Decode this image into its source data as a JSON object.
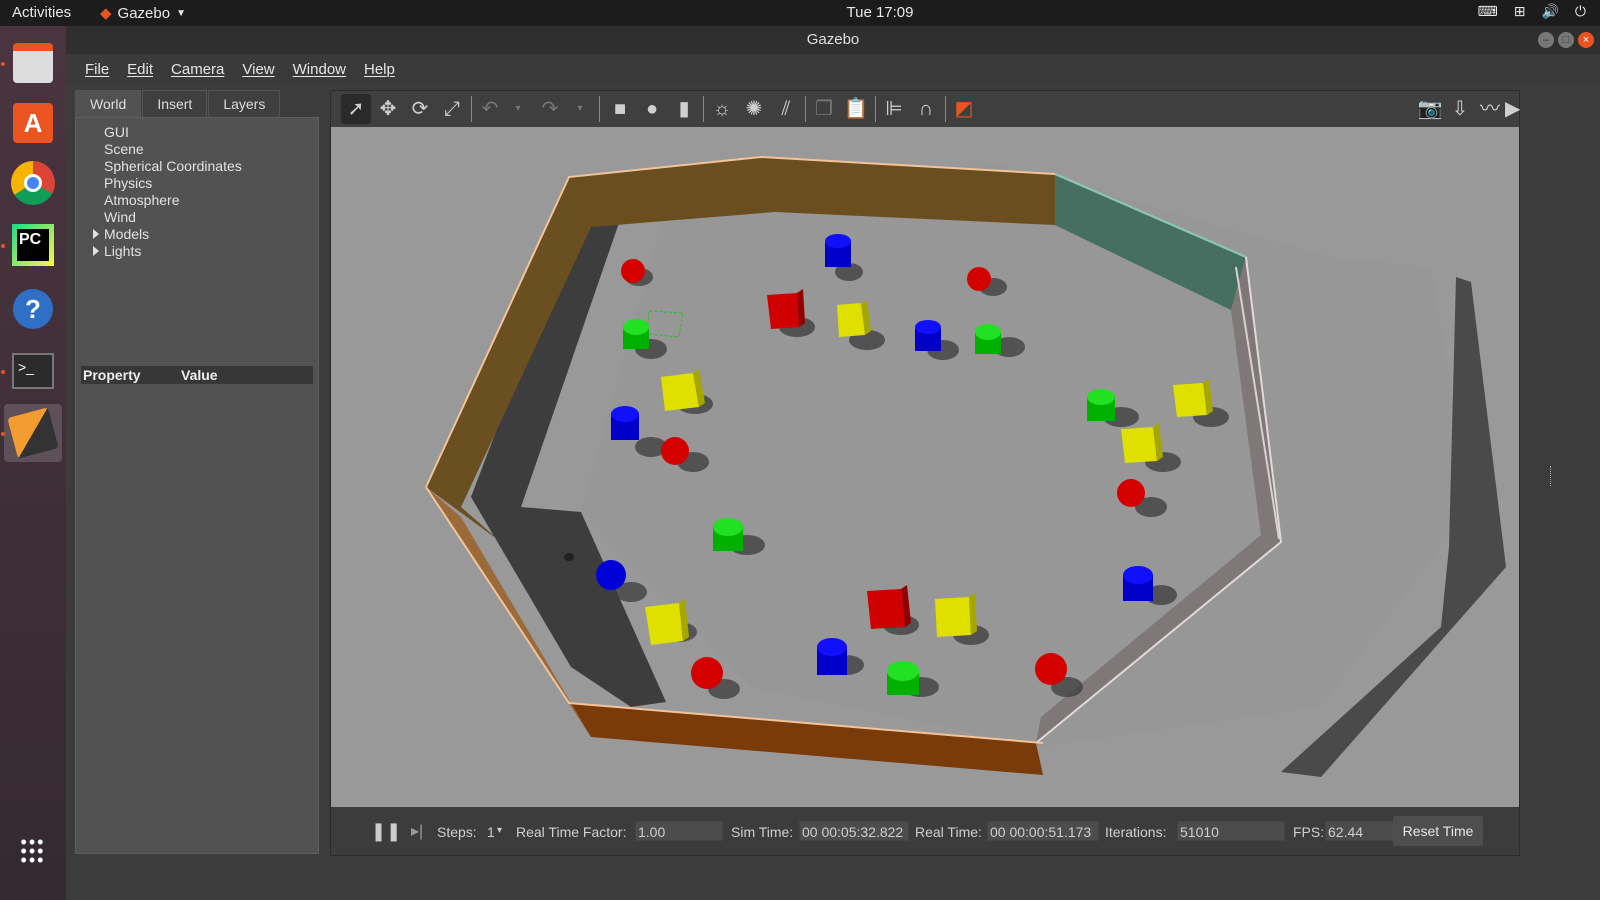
{
  "topbar": {
    "activities": "Activities",
    "app_name": "Gazebo",
    "clock": "Tue 17:09"
  },
  "window": {
    "title": "Gazebo"
  },
  "menu": [
    "File",
    "Edit",
    "Camera",
    "View",
    "Window",
    "Help"
  ],
  "left_panel": {
    "tabs": [
      "World",
      "Insert",
      "Layers"
    ],
    "tree": [
      "GUI",
      "Scene",
      "Spherical Coordinates",
      "Physics",
      "Atmosphere",
      "Wind",
      "Models",
      "Lights"
    ],
    "property_header": "Property",
    "value_header": "Value"
  },
  "toolbar_icons": [
    "select-arrow-icon",
    "translate-icon",
    "rotate-icon",
    "scale-icon",
    "undo-icon",
    "redo-icon",
    "box-icon",
    "sphere-icon",
    "cylinder-icon",
    "point-light-icon",
    "spot-light-icon",
    "directional-light-icon",
    "copy-icon",
    "paste-icon",
    "align-icon",
    "magnet-icon",
    "view-angle-icon",
    "screenshot-icon",
    "log-icon",
    "plot-icon",
    "video-record-icon"
  ],
  "bottom": {
    "steps_label": "Steps:",
    "steps_value": "1",
    "rtf_label": "Real Time Factor:",
    "rtf_value": "1.00",
    "sim_label": "Sim Time:",
    "sim_value": "00 00:05:32.822",
    "real_label": "Real Time:",
    "real_value": "00 00:00:51.173",
    "iter_label": "Iterations:",
    "iter_value": "51010",
    "fps_label": "FPS:",
    "fps_value": "62.44",
    "reset_label": "Reset Time"
  },
  "colors": {
    "accent": "#e95420",
    "floor": "#999999",
    "wall": "#6b4e1f",
    "red": "#e00000",
    "green": "#00cc00",
    "blue": "#0000ee",
    "yellow": "#e6e600"
  }
}
